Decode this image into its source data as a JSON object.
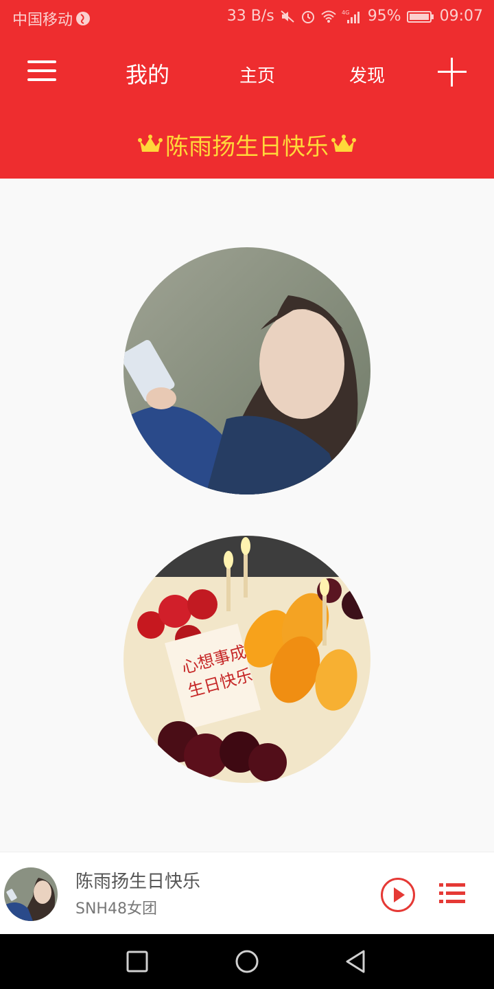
{
  "status_bar": {
    "carrier": "中国移动",
    "net_speed": "33 B/s",
    "network": "4G",
    "battery": "95%",
    "time": "09:07"
  },
  "app_bar": {
    "tabs": [
      {
        "label": "我的",
        "active": true
      },
      {
        "label": "主页",
        "active": false
      },
      {
        "label": "发现",
        "active": false
      }
    ]
  },
  "banner": {
    "text": "陈雨扬生日快乐"
  },
  "player": {
    "title": "陈雨扬生日快乐",
    "artist": "SNH48女团"
  },
  "colors": {
    "primary": "#ee2d2f",
    "banner_text": "#ffd83a",
    "background": "#f9f9f9"
  },
  "icons": [
    "menu-icon",
    "add-icon",
    "crown-icon",
    "play-icon",
    "playlist-icon",
    "back-icon",
    "home-icon",
    "recent-apps-icon"
  ]
}
